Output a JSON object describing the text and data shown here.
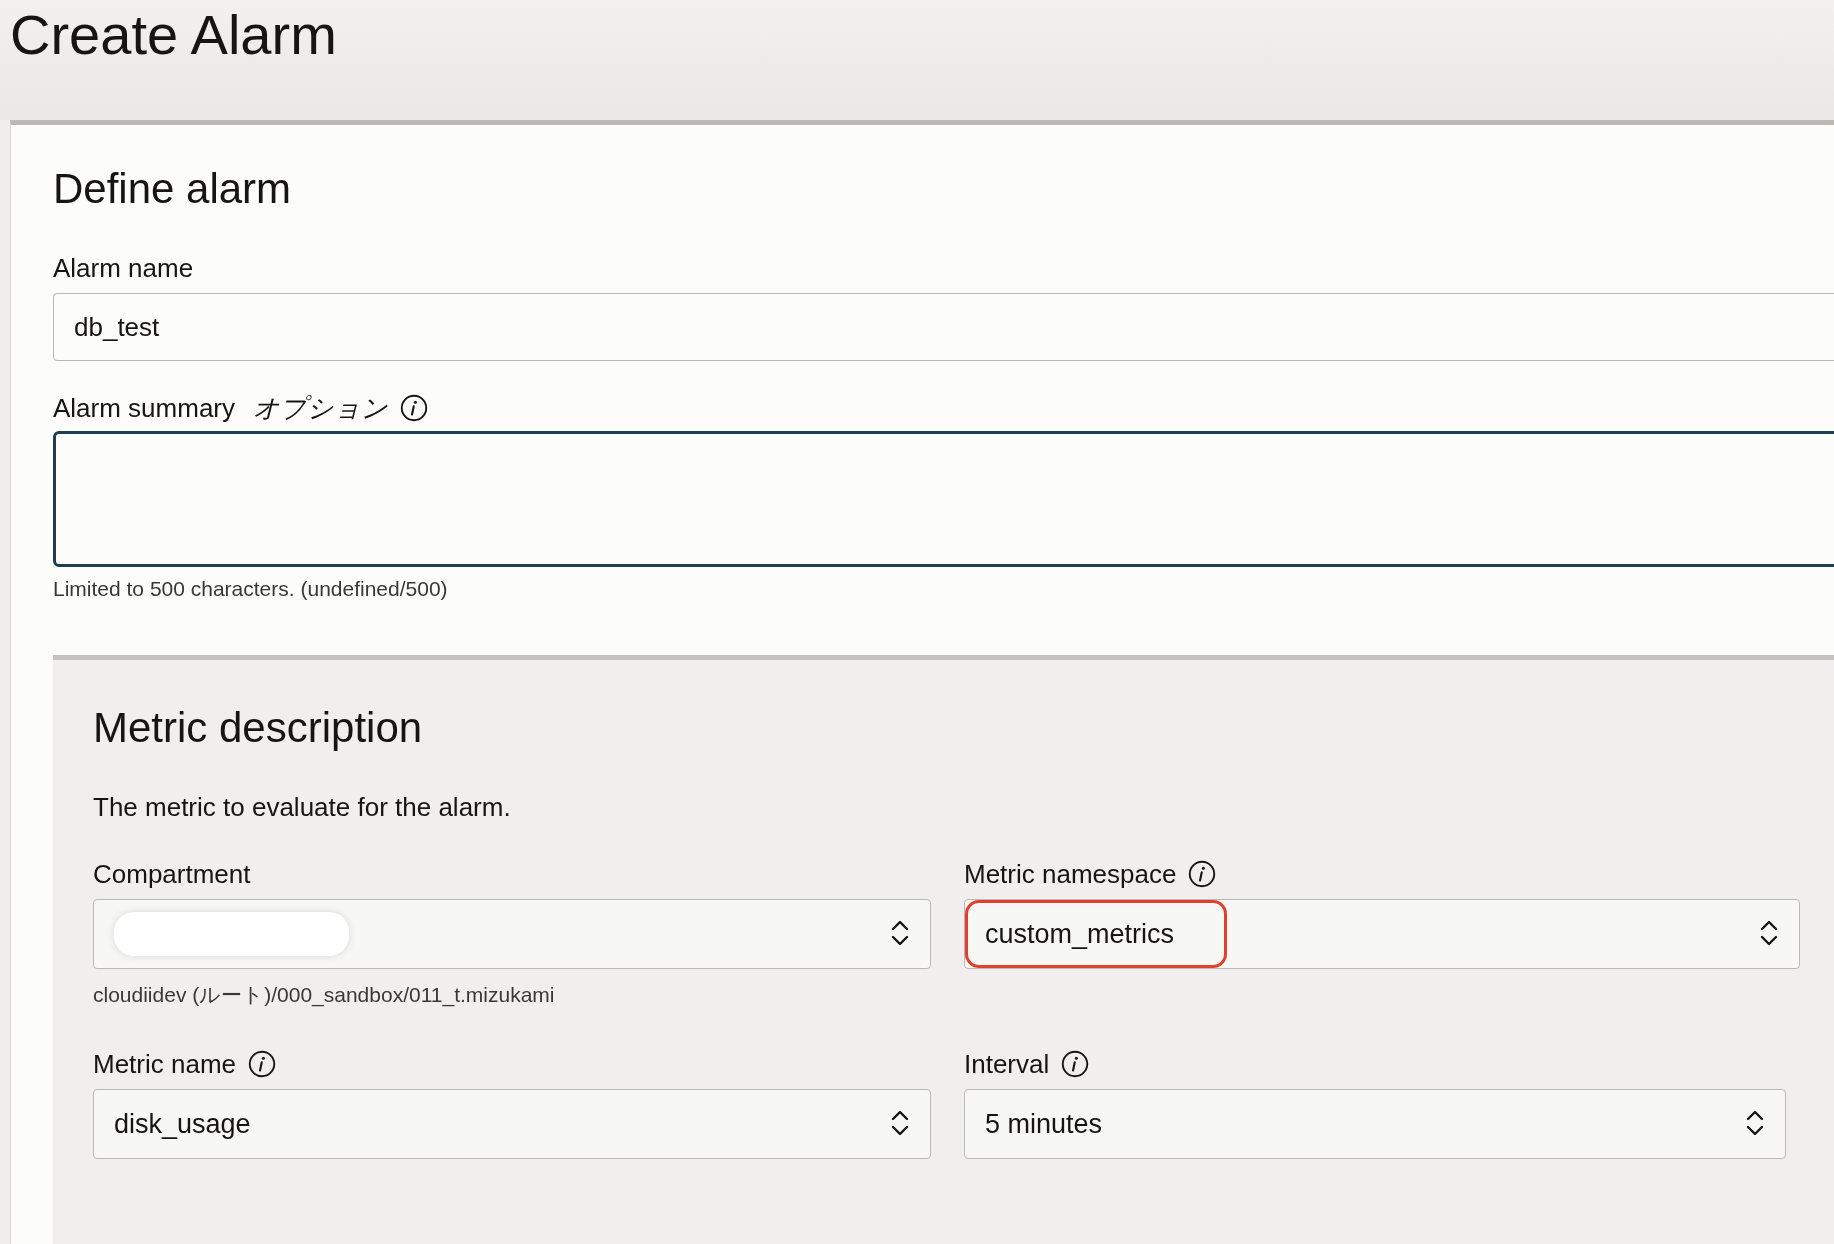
{
  "page": {
    "title": "Create Alarm"
  },
  "define_alarm": {
    "heading": "Define alarm",
    "alarm_name": {
      "label": "Alarm name",
      "value": "db_test"
    },
    "alarm_summary": {
      "label": "Alarm summary",
      "optional": "オプション",
      "info": true,
      "focused": true,
      "helper": "Limited to 500 characters. (undefined/500)"
    }
  },
  "metric_description": {
    "heading": "Metric description",
    "description": "The metric to evaluate for the alarm.",
    "fields": [
      {
        "label": "Compartment",
        "info": false,
        "redacted": true,
        "highlighted": false,
        "hint": "cloudiidev (ルート)/000_sandbox/011_t.mizukami"
      },
      {
        "label": "Metric namespace",
        "info": true,
        "value": "custom_metrics",
        "redacted": false,
        "highlighted": true
      },
      {
        "label": "Metric name",
        "info": true,
        "value": "disk_usage",
        "redacted": false,
        "highlighted": false
      },
      {
        "label": "Interval",
        "info": true,
        "value": "5 minutes",
        "redacted": false,
        "highlighted": false
      }
    ]
  }
}
